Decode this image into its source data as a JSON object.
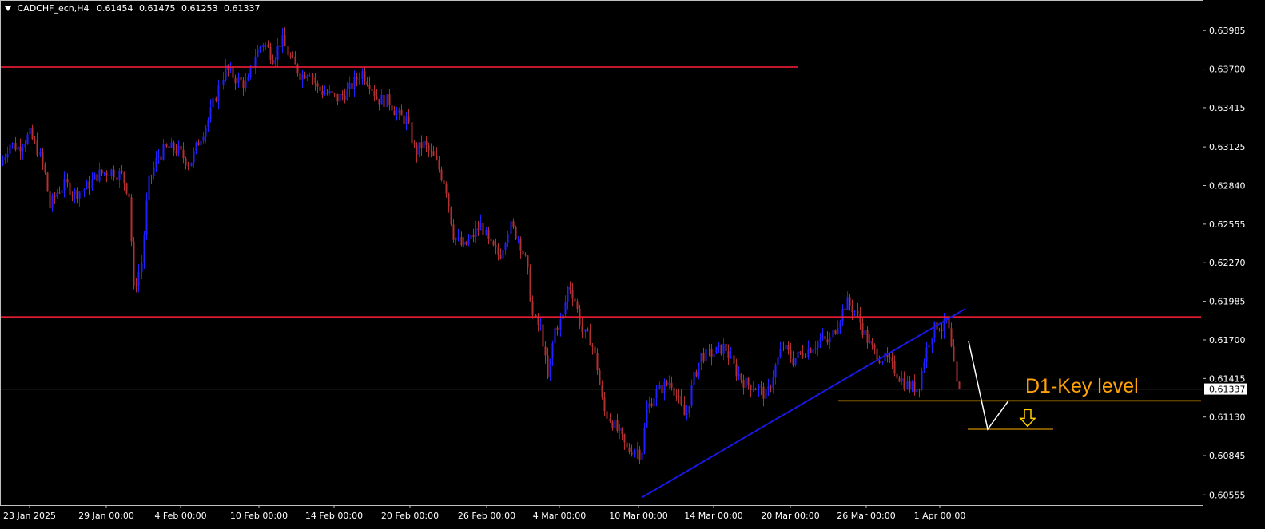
{
  "header": {
    "symbol": "CADCHF_ecn,H4",
    "open": "0.61454",
    "high": "0.61475",
    "low": "0.61253",
    "close": "0.61337"
  },
  "colors": {
    "background": "#000000",
    "axis": "#c0c0c0",
    "bull_candle": "#1f1fff",
    "bear_candle": "#b0312f",
    "resistance_line": "#ff1f3a",
    "trendline": "#1818e0",
    "key_level": "#ffb000",
    "annotation_text": "#ffa20a",
    "arrow": "#ffd000",
    "bid_line": "#808080",
    "path_line": "#ffffff"
  },
  "chart_data": {
    "type": "candlestick",
    "symbol": "CADCHF_ecn",
    "timeframe": "H4",
    "current_price": 0.61337,
    "current_price_label": "0.61337",
    "ylim": [
      0.6048,
      0.6421
    ],
    "y_ticks": [
      "0.63985",
      "0.63700",
      "0.63415",
      "0.63125",
      "0.62840",
      "0.62555",
      "0.62270",
      "0.61985",
      "0.61700",
      "0.61415",
      "0.61130",
      "0.60845",
      "0.60555"
    ],
    "x_ticks": [
      "23 Jan 2025",
      "29 Jan 00:00",
      "4 Feb 00:00",
      "10 Feb 00:00",
      "14 Feb 00:00",
      "20 Feb 00:00",
      "26 Feb 00:00",
      "4 Mar 00:00",
      "10 Mar 00:00",
      "14 Mar 00:00",
      "20 Mar 00:00",
      "26 Mar 00:00",
      "1 Apr 00:00"
    ],
    "price_path": [
      [
        0,
        0.6295
      ],
      [
        15,
        0.6315
      ],
      [
        25,
        0.6312
      ],
      [
        40,
        0.6322
      ],
      [
        50,
        0.631
      ],
      [
        58,
        0.6295
      ],
      [
        65,
        0.6268
      ],
      [
        75,
        0.628
      ],
      [
        85,
        0.6285
      ],
      [
        95,
        0.6278
      ],
      [
        110,
        0.6282
      ],
      [
        125,
        0.6292
      ],
      [
        140,
        0.6295
      ],
      [
        155,
        0.6292
      ],
      [
        165,
        0.6276
      ],
      [
        170,
        0.6205
      ],
      [
        180,
        0.6228
      ],
      [
        188,
        0.6285
      ],
      [
        200,
        0.6305
      ],
      [
        212,
        0.6312
      ],
      [
        225,
        0.631
      ],
      [
        240,
        0.63
      ],
      [
        250,
        0.6315
      ],
      [
        265,
        0.6335
      ],
      [
        275,
        0.6355
      ],
      [
        285,
        0.637
      ],
      [
        300,
        0.6362
      ],
      [
        312,
        0.6358
      ],
      [
        322,
        0.638
      ],
      [
        332,
        0.639
      ],
      [
        345,
        0.6378
      ],
      [
        355,
        0.6392
      ],
      [
        368,
        0.6375
      ],
      [
        380,
        0.6365
      ],
      [
        390,
        0.637
      ],
      [
        400,
        0.6355
      ],
      [
        412,
        0.6352
      ],
      [
        425,
        0.6348
      ],
      [
        440,
        0.6355
      ],
      [
        455,
        0.6368
      ],
      [
        465,
        0.636
      ],
      [
        475,
        0.6348
      ],
      [
        490,
        0.6346
      ],
      [
        500,
        0.6336
      ],
      [
        512,
        0.6332
      ],
      [
        522,
        0.6308
      ],
      [
        532,
        0.6315
      ],
      [
        545,
        0.6305
      ],
      [
        560,
        0.6285
      ],
      [
        570,
        0.6248
      ],
      [
        582,
        0.6238
      ],
      [
        592,
        0.6245
      ],
      [
        605,
        0.6255
      ],
      [
        615,
        0.624
      ],
      [
        628,
        0.6232
      ],
      [
        640,
        0.6255
      ],
      [
        652,
        0.6245
      ],
      [
        662,
        0.6225
      ],
      [
        670,
        0.6185
      ],
      [
        680,
        0.6178
      ],
      [
        688,
        0.614
      ],
      [
        697,
        0.6178
      ],
      [
        706,
        0.6185
      ],
      [
        714,
        0.6212
      ],
      [
        722,
        0.62
      ],
      [
        732,
        0.6175
      ],
      [
        742,
        0.617
      ],
      [
        750,
        0.615
      ],
      [
        758,
        0.6118
      ],
      [
        768,
        0.611
      ],
      [
        778,
        0.61
      ],
      [
        788,
        0.6088
      ],
      [
        798,
        0.609
      ],
      [
        805,
        0.6085
      ],
      [
        812,
        0.6118
      ],
      [
        822,
        0.613
      ],
      [
        832,
        0.6135
      ],
      [
        842,
        0.614
      ],
      [
        852,
        0.6125
      ],
      [
        860,
        0.6112
      ],
      [
        870,
        0.614
      ],
      [
        880,
        0.6158
      ],
      [
        895,
        0.616
      ],
      [
        910,
        0.6165
      ],
      [
        922,
        0.6148
      ],
      [
        935,
        0.6138
      ],
      [
        950,
        0.6135
      ],
      [
        962,
        0.6128
      ],
      [
        972,
        0.6148
      ],
      [
        982,
        0.6165
      ],
      [
        995,
        0.6155
      ],
      [
        1005,
        0.616
      ],
      [
        1018,
        0.6165
      ],
      [
        1030,
        0.617
      ],
      [
        1040,
        0.6168
      ],
      [
        1052,
        0.6185
      ],
      [
        1062,
        0.6198
      ],
      [
        1072,
        0.6192
      ],
      [
        1082,
        0.6178
      ],
      [
        1092,
        0.6165
      ],
      [
        1102,
        0.6158
      ],
      [
        1112,
        0.6155
      ],
      [
        1122,
        0.6148
      ],
      [
        1132,
        0.614
      ],
      [
        1142,
        0.6135
      ],
      [
        1152,
        0.6135
      ],
      [
        1160,
        0.6158
      ],
      [
        1168,
        0.6175
      ],
      [
        1176,
        0.6182
      ],
      [
        1182,
        0.6178
      ],
      [
        1188,
        0.6185
      ],
      [
        1194,
        0.616
      ],
      [
        1200,
        0.6134
      ]
    ],
    "lines": [
      {
        "name": "resistance-upper",
        "type": "horizontal",
        "price": 0.63715,
        "x_from": 0,
        "x_to": 998
      },
      {
        "name": "resistance-lower",
        "type": "horizontal",
        "price": 0.6187,
        "x_from": 0,
        "x_to": 1503
      },
      {
        "name": "ascending-trendline",
        "type": "segment",
        "points": [
          [
            803,
            0.60535
          ],
          [
            1208,
            0.6193
          ]
        ]
      },
      {
        "name": "d1-key-level",
        "type": "horizontal",
        "price": 0.6125,
        "x_from": 1049,
        "x_to": 1503
      },
      {
        "name": "target-level",
        "type": "horizontal",
        "price": 0.6104,
        "x_from": 1211,
        "x_to": 1318
      },
      {
        "name": "projection-path",
        "type": "polyline",
        "points": [
          [
            1212,
            0.6169
          ],
          [
            1236,
            0.6104
          ],
          [
            1262,
            0.6125
          ]
        ]
      }
    ],
    "annotations": [
      {
        "text": "D1-Key level",
        "x": 1283,
        "price": 0.6137
      }
    ],
    "arrow": {
      "direction": "down",
      "x": 1286,
      "price": 0.6112
    }
  }
}
